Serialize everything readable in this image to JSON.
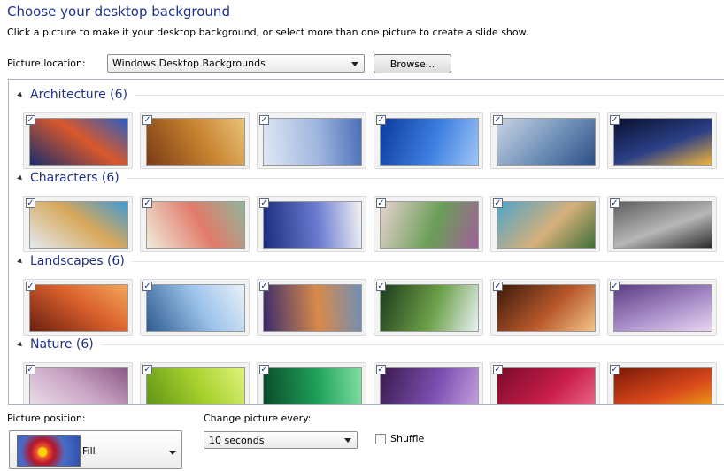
{
  "header": {
    "title": "Choose your desktop background",
    "subtitle": "Click a picture to make it your desktop background, or select more than one picture to create a slide show."
  },
  "location": {
    "label": "Picture location:",
    "value": "Windows Desktop Backgrounds",
    "browse_label": "Browse..."
  },
  "groups": [
    {
      "name": "Architecture (6)",
      "thumbs": [
        {
          "checked": true,
          "colors": [
            "#1b2d6b",
            "#d9582b",
            "#2a5fc2"
          ]
        },
        {
          "checked": true,
          "colors": [
            "#7a3b16",
            "#c7822e",
            "#e8c27a"
          ]
        },
        {
          "checked": true,
          "colors": [
            "#dfe7f5",
            "#9fb6df",
            "#4b6fb8"
          ]
        },
        {
          "checked": true,
          "colors": [
            "#0c3a9e",
            "#3d7fe0",
            "#9fc6f5"
          ]
        },
        {
          "checked": true,
          "colors": [
            "#c9d4e4",
            "#6d8fb7",
            "#2e4f86"
          ]
        },
        {
          "checked": true,
          "colors": [
            "#0a1030",
            "#2a3f86",
            "#f0b33a"
          ]
        }
      ]
    },
    {
      "name": "Characters (6)",
      "thumbs": [
        {
          "checked": true,
          "colors": [
            "#e3e9ef",
            "#d8a85a",
            "#3c9bd6"
          ]
        },
        {
          "checked": true,
          "colors": [
            "#f0ecdc",
            "#e27b6a",
            "#8fb79a"
          ]
        },
        {
          "checked": true,
          "colors": [
            "#1c2c7e",
            "#6a7bd0",
            "#f2f2f2"
          ]
        },
        {
          "checked": true,
          "colors": [
            "#e7d3cf",
            "#6a9e57",
            "#a25f9a"
          ]
        },
        {
          "checked": true,
          "colors": [
            "#4fa4c8",
            "#d7b07a",
            "#3f6f3a"
          ]
        },
        {
          "checked": true,
          "colors": [
            "#5e5e5e",
            "#b7b7b7",
            "#2c2c2c"
          ]
        }
      ]
    },
    {
      "name": "Landscapes (6)",
      "thumbs": [
        {
          "checked": true,
          "colors": [
            "#6a1f10",
            "#d9602c",
            "#f3a65a"
          ]
        },
        {
          "checked": true,
          "colors": [
            "#2e5a8f",
            "#9cc3ea",
            "#e9f1f8"
          ]
        },
        {
          "checked": true,
          "colors": [
            "#3a2b6a",
            "#d98a4a",
            "#6f8fb8"
          ]
        },
        {
          "checked": true,
          "colors": [
            "#1d3b1a",
            "#6da14a",
            "#e9f1f4"
          ]
        },
        {
          "checked": true,
          "colors": [
            "#3b1a0d",
            "#b8582a",
            "#f2c689"
          ]
        },
        {
          "checked": true,
          "colors": [
            "#5b3c82",
            "#a98ec9",
            "#e8d6f0"
          ]
        }
      ]
    },
    {
      "name": "Nature (6)",
      "thumbs": [
        {
          "checked": true,
          "colors": [
            "#f0e6ef",
            "#c9a4c4",
            "#8b5a86"
          ]
        },
        {
          "checked": true,
          "colors": [
            "#5a8f12",
            "#a7d12e",
            "#e0f27a"
          ]
        },
        {
          "checked": true,
          "colors": [
            "#0a4a2a",
            "#1fa05a",
            "#7fe0a0"
          ]
        },
        {
          "checked": true,
          "colors": [
            "#3a1a4e",
            "#7b4fb0",
            "#c9a3e0"
          ]
        },
        {
          "checked": true,
          "colors": [
            "#7a0a2a",
            "#c81e4a",
            "#f0708e"
          ]
        },
        {
          "checked": true,
          "colors": [
            "#7a1a0a",
            "#d9481a",
            "#f2b21a"
          ]
        }
      ]
    }
  ],
  "position": {
    "label": "Picture position:",
    "value": "Fill"
  },
  "interval": {
    "label": "Change picture every:",
    "value": "10 seconds"
  },
  "shuffle": {
    "label": "Shuffle",
    "checked": false
  }
}
